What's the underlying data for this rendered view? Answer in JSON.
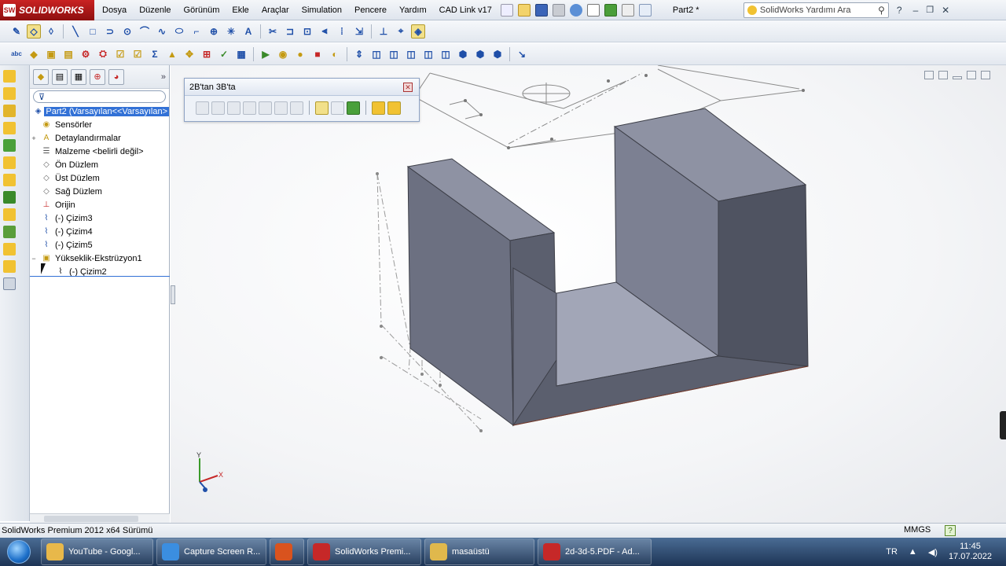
{
  "app": {
    "brand": "SOLIDWORKS",
    "document_title": "Part2 *",
    "search_placeholder": "SolidWorks Yardımı Ara"
  },
  "menu": [
    "Dosya",
    "Düzenle",
    "Görünüm",
    "Ekle",
    "Araçlar",
    "Simulation",
    "Pencere",
    "Yardım",
    "CAD Link v17"
  ],
  "toolbox": {
    "title": "2B'tan 3B'ta"
  },
  "tree": {
    "root": "Part2  (Varsayılan<<Varsayılan>",
    "items": [
      {
        "label": "Sensörler",
        "icon": "sensor-icon",
        "expander": ""
      },
      {
        "label": "Detaylandırmalar",
        "icon": "annotation-icon",
        "expander": "+"
      },
      {
        "label": "Malzeme <belirli değil>",
        "icon": "material-icon",
        "expander": ""
      },
      {
        "label": "Ön Düzlem",
        "icon": "plane-icon",
        "expander": ""
      },
      {
        "label": "Üst Düzlem",
        "icon": "plane-icon",
        "expander": ""
      },
      {
        "label": "Sağ Düzlem",
        "icon": "plane-icon",
        "expander": ""
      },
      {
        "label": "Orijin",
        "icon": "origin-icon",
        "expander": ""
      },
      {
        "label": "(-) Çizim3",
        "icon": "sketch-icon",
        "expander": ""
      },
      {
        "label": "(-) Çizim4",
        "icon": "sketch-icon",
        "expander": ""
      },
      {
        "label": "(-) Çizim5",
        "icon": "sketch-icon",
        "expander": ""
      },
      {
        "label": "Yükseklik-Ekstrüzyon1",
        "icon": "extrude-icon",
        "expander": "−"
      }
    ],
    "child": "(-) Çizim2"
  },
  "axis": {
    "x": "X",
    "y": "Y"
  },
  "status": {
    "text": "SolidWorks Premium 2012 x64 Sürümü",
    "units": "MMGS",
    "help": "?"
  },
  "taskbar": {
    "tasks": [
      {
        "label": "YouTube - Googl...",
        "color": "#e8b84a"
      },
      {
        "label": "Capture Screen R...",
        "color": "#3b8ee0"
      },
      {
        "label": "",
        "color": "#d9531e"
      },
      {
        "label": "SolidWorks Premi...",
        "color": "#c62828"
      },
      {
        "label": "masaüstü",
        "color": "#e0b84c"
      },
      {
        "label": "2d-3d-5.PDF - Ad...",
        "color": "#c62828"
      }
    ],
    "language": "TR",
    "time": "11:45",
    "date": "17.07.2022"
  },
  "colors": {
    "model_face_front": "#5b5f6e",
    "model_face_top": "#8e92a3",
    "model_face_side": "#6c7081",
    "tree_selection": "#3271d6",
    "brand_red": "#b31818"
  }
}
